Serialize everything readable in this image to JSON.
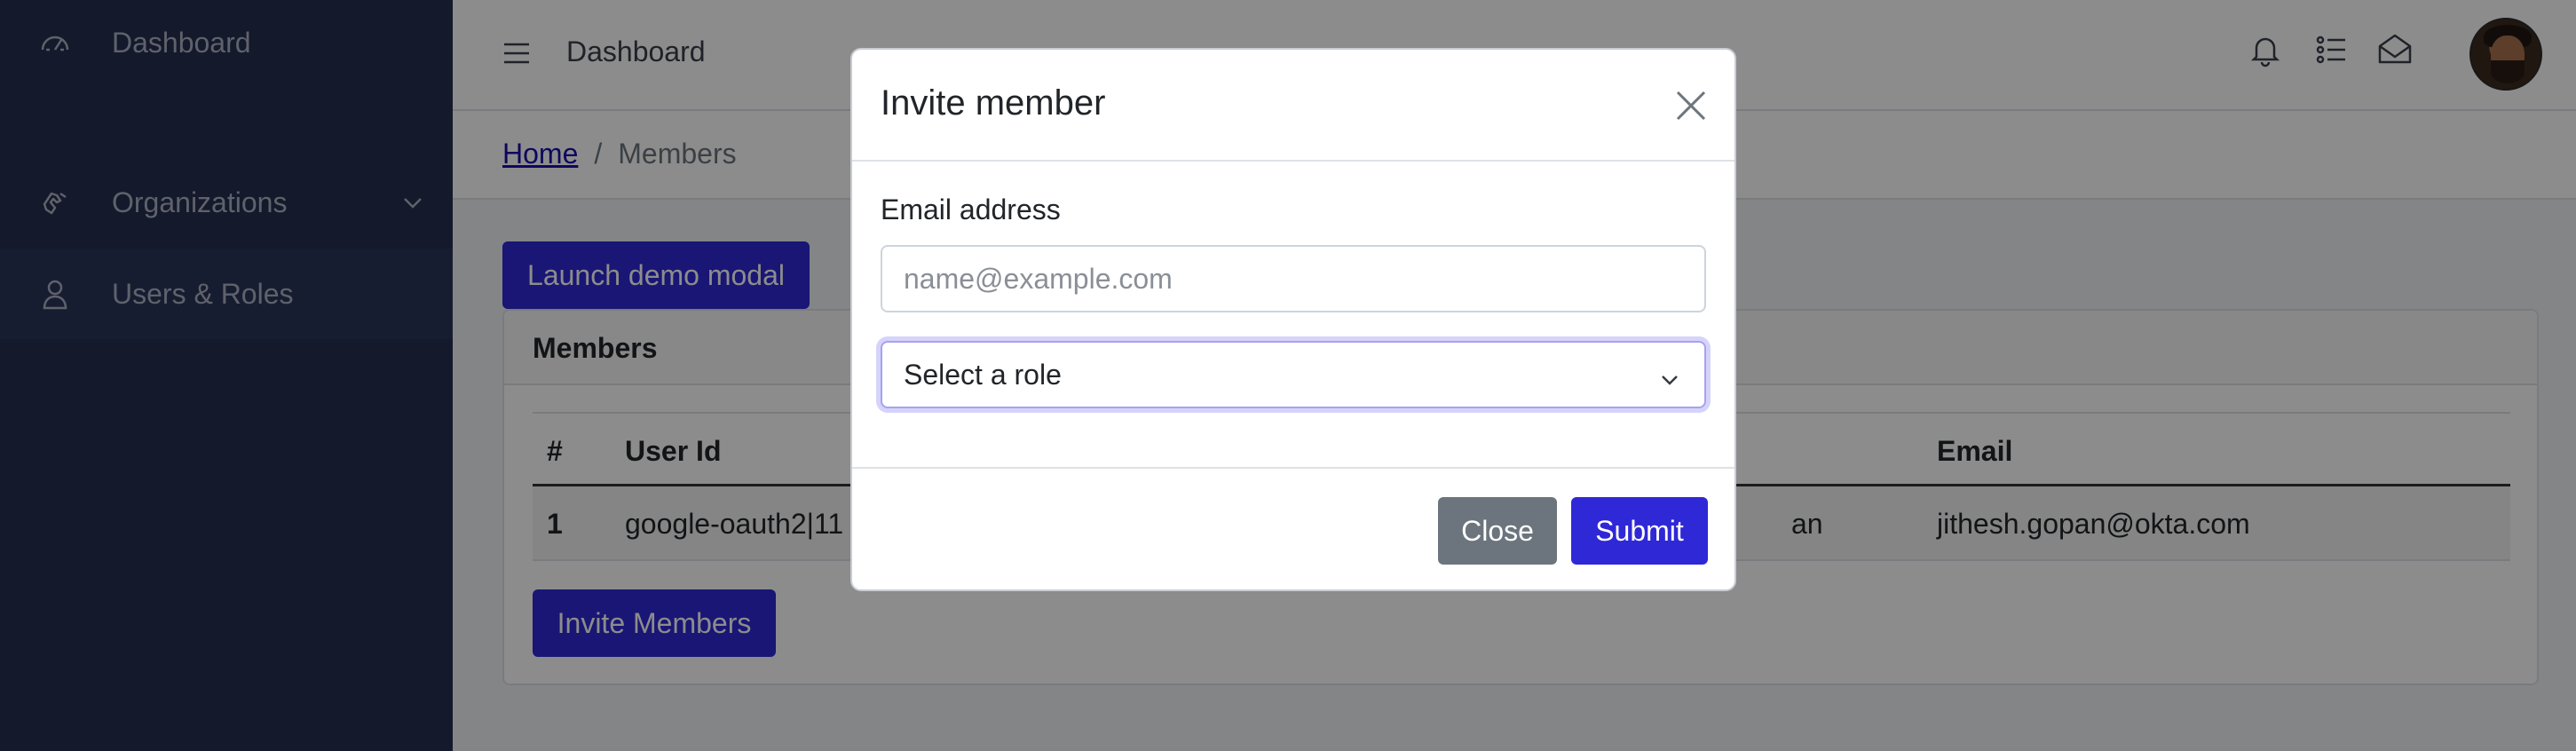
{
  "sidebar": {
    "items": [
      {
        "label": "Dashboard",
        "icon": "speedometer-icon"
      },
      {
        "label": "Organizations",
        "icon": "hand-icon"
      },
      {
        "label": "Users & Roles",
        "icon": "user-icon"
      }
    ]
  },
  "header": {
    "title": "Dashboard",
    "icons": [
      "bell-icon",
      "list-icon",
      "mail-icon"
    ]
  },
  "breadcrumb": {
    "home": "Home",
    "separator": "/",
    "current": "Members"
  },
  "main": {
    "demo_button": "Launch demo modal",
    "card_title": "Members",
    "table": {
      "headers": [
        "#",
        "User Id",
        "Email"
      ],
      "rows": [
        {
          "num": "1",
          "user_id": "google-oauth2|11",
          "name_fragment": "an",
          "email": "jithesh.gopan@okta.com"
        }
      ]
    },
    "invite_button": "Invite Members"
  },
  "modal": {
    "title": "Invite member",
    "email_label": "Email address",
    "email_placeholder": "name@example.com",
    "email_value": "",
    "role_select": "Select a role",
    "close_label": "Close",
    "submit_label": "Submit"
  },
  "colors": {
    "sidebar_bg": "#252e4f",
    "primary": "#2f28d6",
    "secondary": "#6c757d"
  }
}
